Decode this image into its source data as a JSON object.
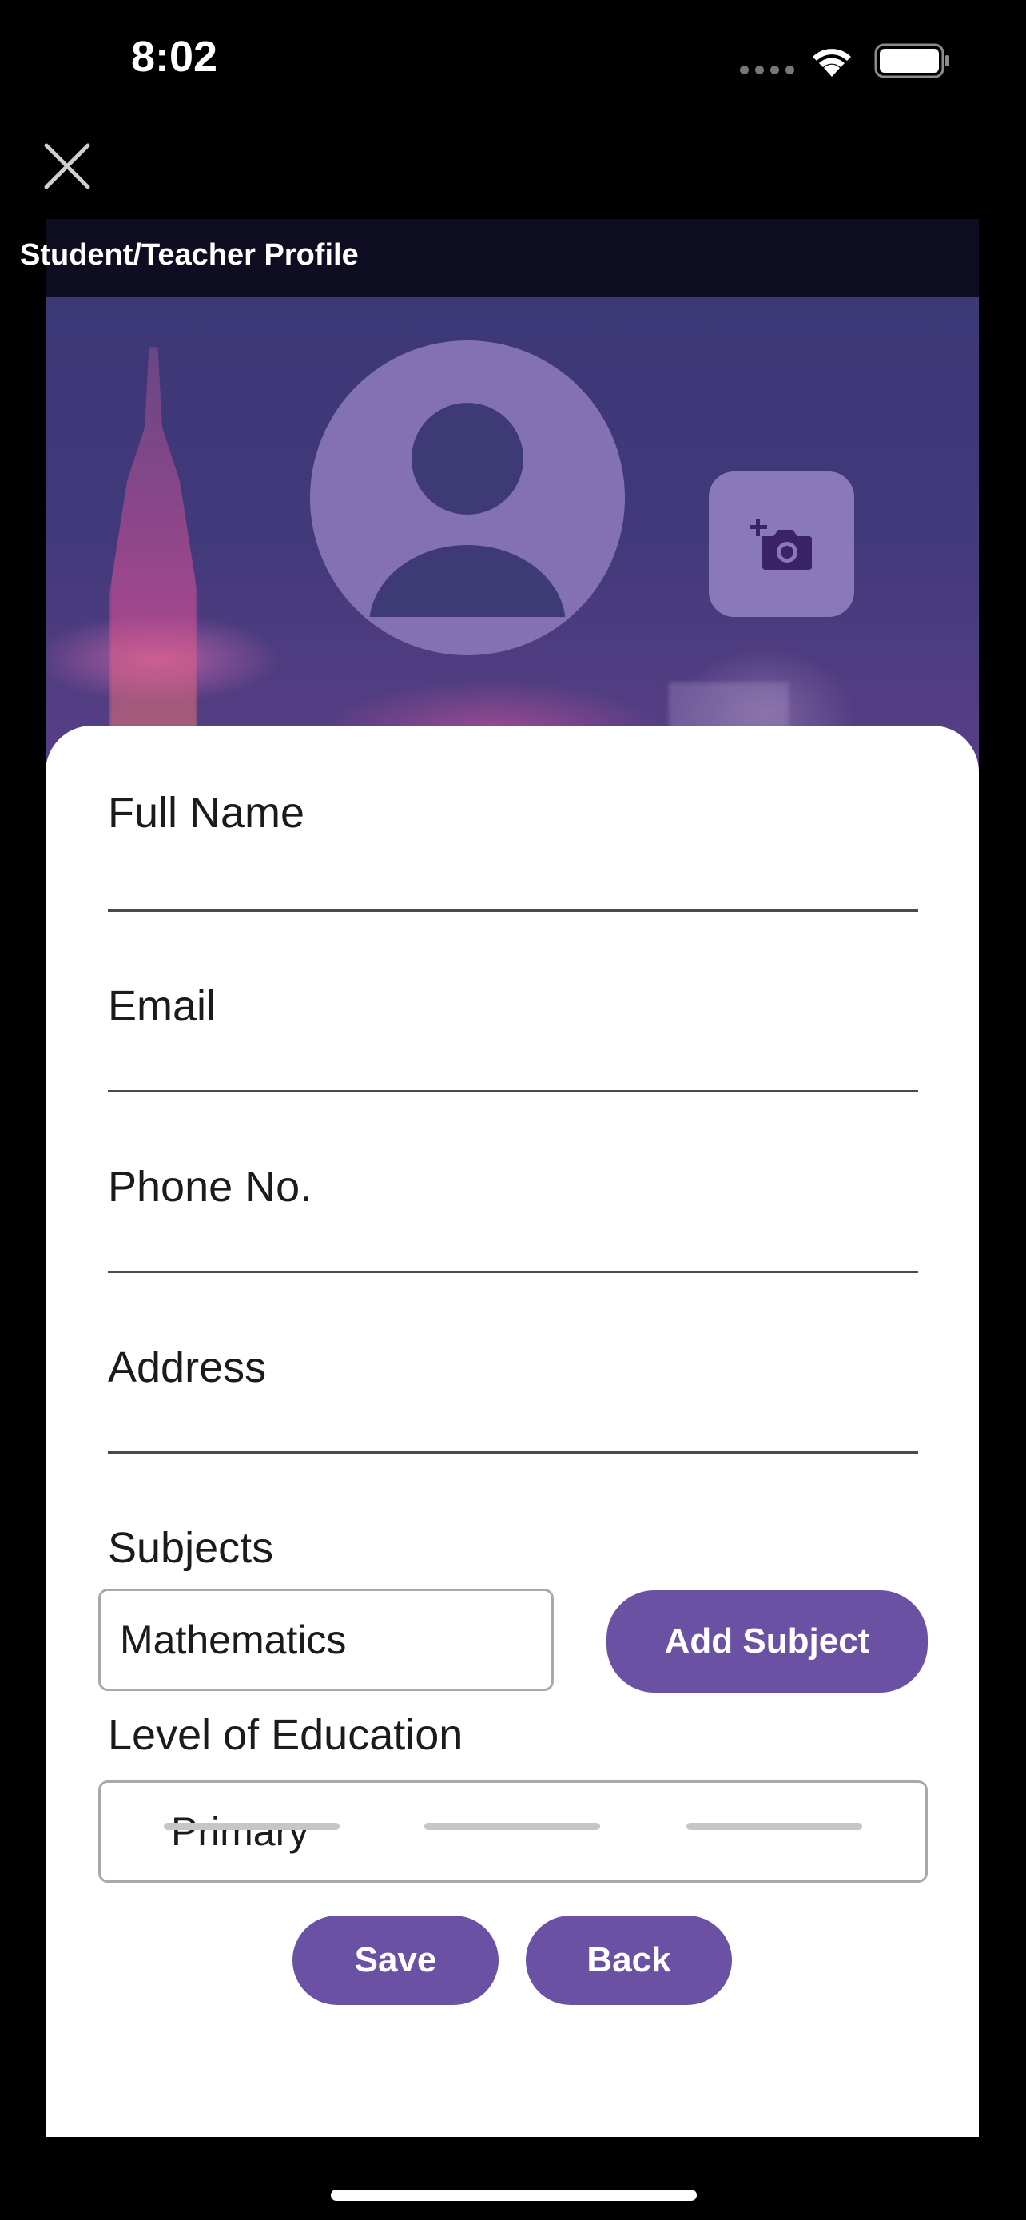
{
  "status_bar": {
    "time": "8:02"
  },
  "app": {
    "title": "Student/Teacher Profile",
    "colors": {
      "primary": "#6a51a3",
      "avatar_fill": "#8371b4",
      "header_bg": "#0c0a1c"
    }
  },
  "icons": {
    "close": "close-icon",
    "avatar": "user-avatar-icon",
    "camera": "add-photo-camera-icon"
  },
  "form": {
    "full_name": {
      "label": "Full Name",
      "value": ""
    },
    "email": {
      "label": "Email",
      "value": ""
    },
    "phone": {
      "label": "Phone No.",
      "value": ""
    },
    "address": {
      "label": "Address",
      "value": ""
    },
    "subjects": {
      "label": "Subjects",
      "value": "Mathematics",
      "add_label": "Add Subject"
    },
    "education": {
      "label": "Level of Education",
      "value": "Primary"
    },
    "save_label": "Save",
    "back_label": "Back"
  }
}
